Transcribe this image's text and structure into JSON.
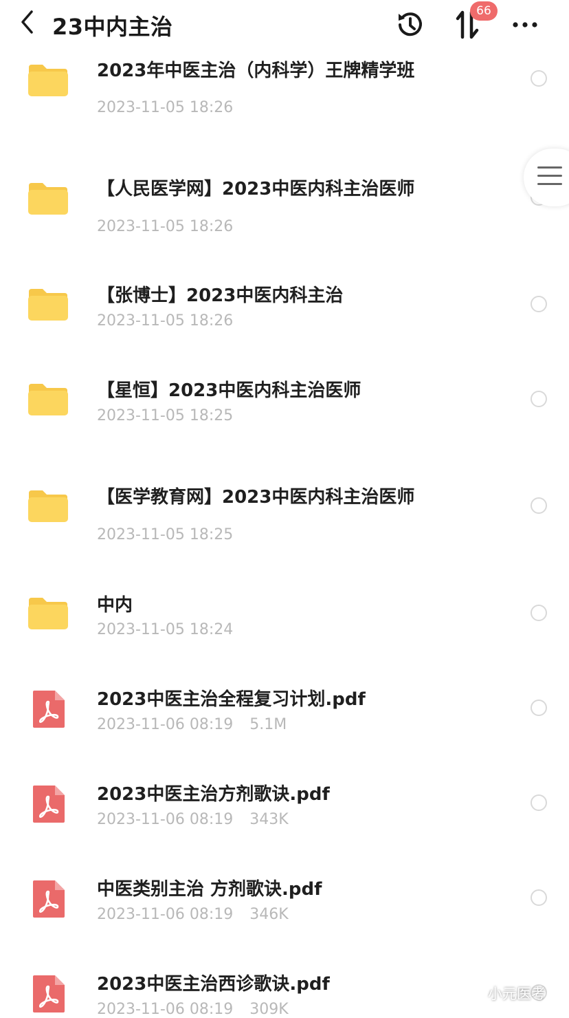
{
  "header": {
    "title": "23中内主治",
    "transfer_badge": "66"
  },
  "files": [
    {
      "type": "folder",
      "name": "2023年中医主治（内科学）王牌精学班",
      "date": "2023-11-05 18:26",
      "size": ""
    },
    {
      "type": "folder",
      "name": "【人民医学网】2023中医内科主治医师",
      "date": "2023-11-05 18:26",
      "size": ""
    },
    {
      "type": "folder",
      "name": "【张博士】2023中医内科主治",
      "date": "2023-11-05 18:26",
      "size": ""
    },
    {
      "type": "folder",
      "name": "【星恒】2023中医内科主治医师",
      "date": "2023-11-05 18:25",
      "size": ""
    },
    {
      "type": "folder",
      "name": "【医学教育网】2023中医内科主治医师",
      "date": "2023-11-05 18:25",
      "size": ""
    },
    {
      "type": "folder",
      "name": "中内",
      "date": "2023-11-05 18:24",
      "size": ""
    },
    {
      "type": "pdf",
      "name": "2023中医主治全程复习计划.pdf",
      "date": "2023-11-06 08:19",
      "size": "5.1M"
    },
    {
      "type": "pdf",
      "name": "2023中医主治方剂歌诀.pdf",
      "date": "2023-11-06 08:19",
      "size": "343K"
    },
    {
      "type": "pdf",
      "name": "中医类别主治 方剂歌诀.pdf",
      "date": "2023-11-06 08:19",
      "size": "346K"
    },
    {
      "type": "pdf",
      "name": "2023中医主治西诊歌诀.pdf",
      "date": "2023-11-06 08:19",
      "size": "309K"
    }
  ],
  "watermark": {
    "text": "小元医考"
  },
  "colors": {
    "folder": "#fcd65e",
    "folder_tab": "#f7c84a",
    "pdf": "#ea6a6a",
    "badge": "#ef6b6b",
    "meta_text": "#b8b8b8"
  },
  "icons": {
    "back": "chevron-left-icon",
    "history": "history-clock-icon",
    "transfer": "up-down-arrows-icon",
    "more": "more-dots-icon",
    "float": "menu-lines-icon",
    "folder": "folder-icon",
    "pdf": "pdf-file-icon",
    "watermark": "wechat-icon"
  }
}
